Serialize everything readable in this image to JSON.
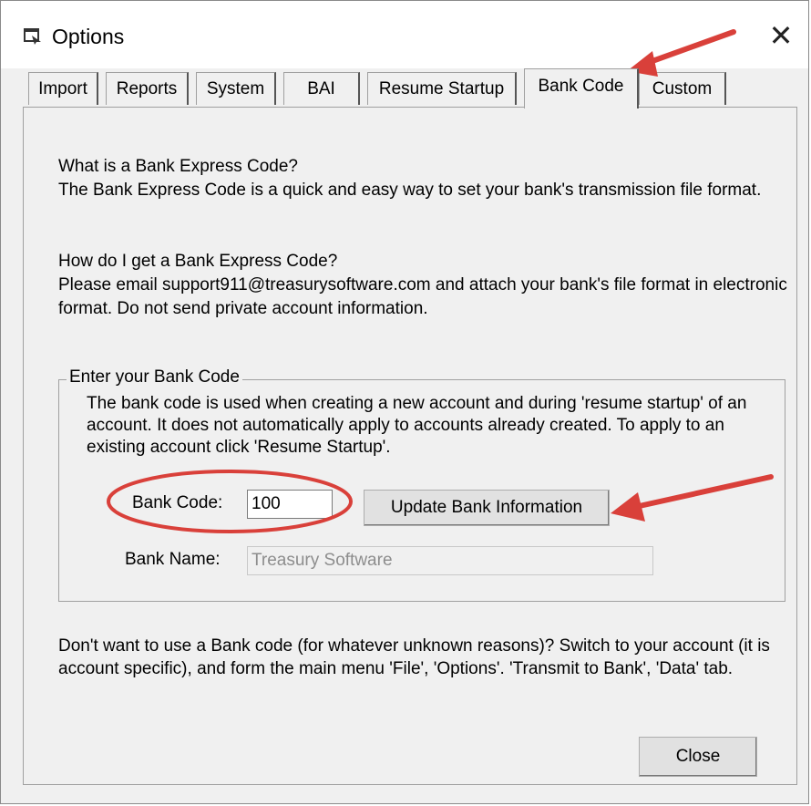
{
  "window": {
    "title": "Options",
    "close_glyph": "✕",
    "icon": "window-options-icon"
  },
  "tabs": [
    {
      "label": "Import"
    },
    {
      "label": "Reports"
    },
    {
      "label": "System"
    },
    {
      "label": "BAI"
    },
    {
      "label": "Resume Startup"
    },
    {
      "label": "Bank Code",
      "active": true
    },
    {
      "label": "Custom"
    }
  ],
  "content": {
    "intro": "What is a Bank Express Code?\nThe Bank Express Code is a quick and easy way to set your bank's transmission file format.",
    "howto": "How do I get a Bank Express Code?\nPlease email support911@treasurysoftware.com and attach your bank's file format in electronic format. Do not send private account information.",
    "group": {
      "legend": "Enter your Bank Code",
      "description": "The bank code is used when creating a new account and during 'resume startup' of an account.  It does not automatically apply to accounts already created.  To apply to an existing account click 'Resume Startup'.",
      "bank_code_label": "Bank Code:",
      "bank_code_value": "100",
      "update_button": "Update Bank Information",
      "bank_name_label": "Bank Name:",
      "bank_name_value": "Treasury Software"
    },
    "footer_note": "Don't want to use a Bank code (for whatever unknown reasons)?  Switch to your account (it is account specific), and form the main menu 'File', 'Options'. 'Transmit to Bank', 'Data' tab.",
    "close_button": "Close"
  },
  "annotation_colors": {
    "arrow": "#d9403a",
    "ellipse": "#d9403a"
  }
}
